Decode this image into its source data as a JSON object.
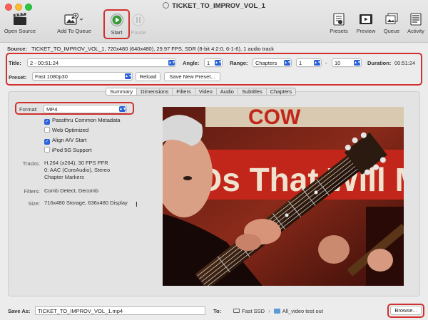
{
  "window": {
    "title": "TICKET_TO_IMPROV_VOL_1"
  },
  "toolbar": {
    "open_source": "Open Source",
    "add_to_queue": "Add To Queue",
    "start": "Start",
    "pause": "Pause",
    "presets": "Presets",
    "preview": "Preview",
    "queue": "Queue",
    "activity": "Activity"
  },
  "source": {
    "label": "Source:",
    "value": "TICKET_TO_IMPROV_VOL_1, 720x480 (640x480), 29.97 FPS, SDR (8-bit 4:2:0, 6-1-6), 1 audio track"
  },
  "controls": {
    "title_label": "Title:",
    "title_value": "2 - 00:51:24",
    "angle_label": "Angle:",
    "angle_value": "1",
    "range_label": "Range:",
    "range_type": "Chapters",
    "range_from": "1",
    "range_sep": "-",
    "range_to": "10",
    "duration_label": "Duration:",
    "duration_value": "00:51:24",
    "preset_label": "Preset:",
    "preset_value": "Fast 1080p30",
    "reload_button": "Reload",
    "save_preset_button": "Save New Preset..."
  },
  "tabs": [
    "Summary",
    "Dimensions",
    "Filters",
    "Video",
    "Audio",
    "Subtitles",
    "Chapters"
  ],
  "summary": {
    "format_label": "Format:",
    "format_value": "MP4",
    "options": [
      {
        "label": "Passthru Common Metadata",
        "checked": true
      },
      {
        "label": "Web Optimized",
        "checked": false
      },
      {
        "label": "Align A/V Start",
        "checked": true
      },
      {
        "label": "iPod 5G Support",
        "checked": false
      }
    ],
    "tracks_label": "Tracks:",
    "tracks_lines": [
      "H.264 (x264), 30 FPS PFR",
      "0: AAC (CoreAudio), Stereo",
      "Chapter Markers"
    ],
    "filters_label": "Filters:",
    "filters_value": "Comb Detect, Decomb",
    "size_label": "Size:",
    "size_value": "716x480 Storage, 636x480 Display"
  },
  "preview_sign_text": "Ds That Will M",
  "footer": {
    "save_as_label": "Save As:",
    "save_as_value": "TICKET_TO_IMPROV_VOL_1.mp4",
    "to_label": "To:",
    "drive": "Fast SSD",
    "folder": "All_video test out",
    "browse_button": "Browse..."
  },
  "colors": {
    "highlight": "#d0302e",
    "accent": "#2a62d9",
    "start_green": "#3a9a3a"
  }
}
